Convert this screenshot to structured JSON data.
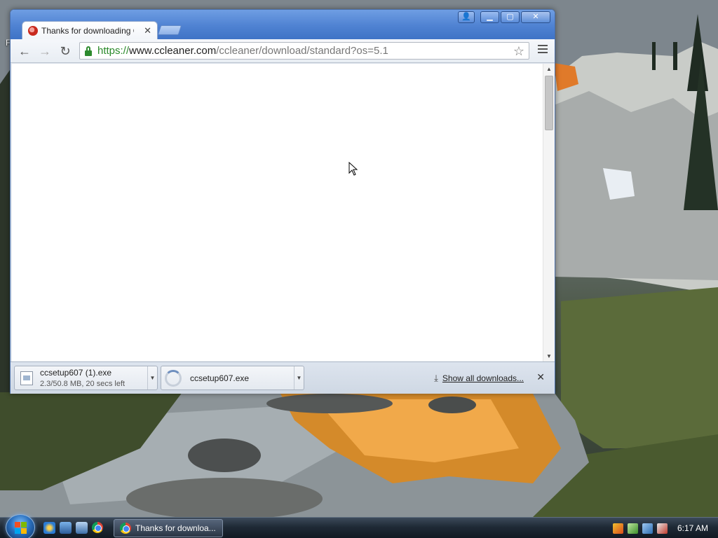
{
  "desktop": {
    "label": "F"
  },
  "browser": {
    "tab": {
      "title": "Thanks for downloading C",
      "close_glyph": "✕"
    },
    "address_bar": {
      "scheme": "https://",
      "host": "www.ccleaner.com",
      "path": "/ccleaner/download/standard?os=5.1"
    },
    "nav": {
      "back_glyph": "←",
      "forward_glyph": "→",
      "reload_glyph": "↻",
      "star_glyph": "☆"
    },
    "window_controls": {
      "profile_glyph": "👤",
      "minimize_glyph": "▁",
      "maximize_glyph": "▢",
      "close_glyph": "✕"
    },
    "scrollbar": {
      "up_glyph": "▲",
      "down_glyph": "▼"
    },
    "download_shelf": {
      "items": [
        {
          "name": "ccsetup607 (1).exe",
          "status": "2.3/50.8 MB, 20 secs left",
          "progress": 0.045
        },
        {
          "name": "ccsetup607.exe",
          "status": ""
        }
      ],
      "dropdown_glyph": "▼",
      "show_all_label": "Show all downloads...",
      "download_glyph": "⤓",
      "close_glyph": "✕"
    }
  },
  "taskbar": {
    "task_button_label": "Thanks for downloa...",
    "clock": "6:17 AM"
  },
  "icons": {
    "favicon": "ccleaner-icon",
    "lock": "lock-icon",
    "star": "star-icon",
    "menu": "menu-icon",
    "file": "file-icon",
    "chrome": "chrome-icon"
  },
  "colors": {
    "secure_green": "#2e8b2e",
    "titlebar_blue": "#4f82d2",
    "taskbar_dark": "#1f2a36"
  }
}
